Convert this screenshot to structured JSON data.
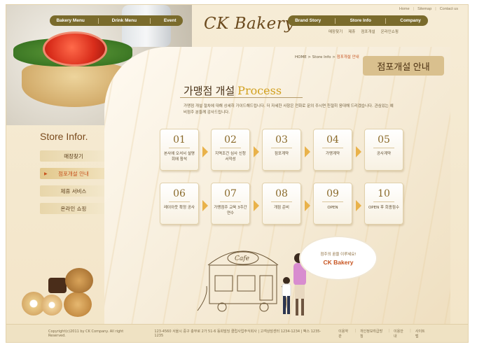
{
  "brand": "CK Bakery",
  "top_links": [
    "Home",
    "Sitemap",
    "Contact us"
  ],
  "left_nav": [
    "Bakery Menu",
    "Drink Menu",
    "Event"
  ],
  "right_nav": [
    "Brand Story",
    "Store Info",
    "Company"
  ],
  "sub_nav": [
    "매장찾기",
    "제휴",
    "점포개설",
    "온라인쇼핑"
  ],
  "sidebar": {
    "title": "Store Infor.",
    "items": [
      "매장찾기",
      "점포개설 안내",
      "제휴 서비스",
      "온라인 쇼핑"
    ],
    "active_index": 1
  },
  "breadcrumb": {
    "path": "HOME > Store Info > ",
    "current": "점포개설 안내"
  },
  "page_title": "점포개설 안내",
  "section": {
    "title_ko": "가맹점 개설",
    "title_en": "Process",
    "desc": "가맹점 개설 절차에 대해 상세히 가이드해드립니다. 더 자세한 사항은 전화로 문의 주시면 친절히 응대해 드리겠습니다. 관심있는 예비점주 분들께 감사드립니다."
  },
  "steps": [
    {
      "num": "01",
      "label": "본사에 오셔서 설명회에 참석"
    },
    {
      "num": "02",
      "label": "지역조건 심사 신청서작성"
    },
    {
      "num": "03",
      "label": "점포계약"
    },
    {
      "num": "04",
      "label": "가맹계약"
    },
    {
      "num": "05",
      "label": "공사계약"
    },
    {
      "num": "06",
      "label": "레이아웃 확정 공사"
    },
    {
      "num": "07",
      "label": "가맹점주 교육 3주간연수"
    },
    {
      "num": "08",
      "label": "개점 준비"
    },
    {
      "num": "09",
      "label": "OPEN"
    },
    {
      "num": "10",
      "label": "OPEN 후 회종점수"
    }
  ],
  "cloud": {
    "line1": "점주의 꿈을 이루세요!",
    "line2": "CK Bakery"
  },
  "illustration_sign": "Cafe",
  "footer": {
    "copyright": "Copyright(c)2011 by CK Company. All right Reserved.",
    "address": "123-4560 서울시 중구 충무로 2가 51-6 동희빌딩 클럽사업주식회사  |  고객상담센터 1234-1234  |  팩스 1235-1235",
    "links": [
      "이용약관",
      "개인정보취급방침",
      "이용안내",
      "사이트맵"
    ]
  },
  "colors": {
    "accent": "#c7531f",
    "nav_bar": "#7a6b2c",
    "brown_text": "#4a3218",
    "gold": "#d2a01e"
  }
}
